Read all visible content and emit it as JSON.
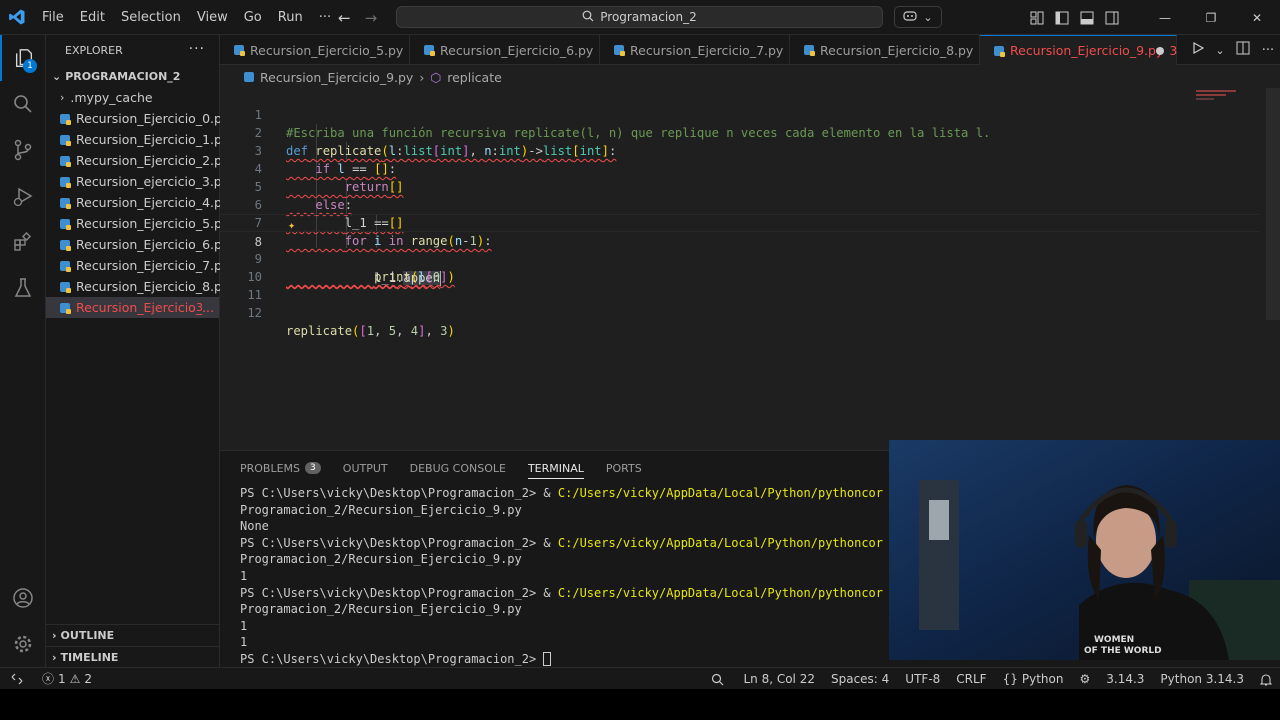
{
  "titlebar": {
    "menu": [
      "File",
      "Edit",
      "Selection",
      "View",
      "Go",
      "Run"
    ],
    "more": "···",
    "search_text": "Programacion_2"
  },
  "activitybar": {
    "explorer_badge": "1"
  },
  "sidebar": {
    "title": "EXPLORER",
    "more": "···",
    "folder": "PROGRAMACION_2",
    "items": [
      {
        "label": ".mypy_cache",
        "type": "folder"
      },
      {
        "label": "Recursion_Ejercicio_0.py"
      },
      {
        "label": "Recursion_Ejercicio_1.py"
      },
      {
        "label": "Recursion_Ejercicio_2.py"
      },
      {
        "label": "Recursion_ejercicio_3.py"
      },
      {
        "label": "Recursion_Ejercicio_4.py"
      },
      {
        "label": "Recursion_Ejercicio_5.py"
      },
      {
        "label": "Recursion_Ejercicio_6.py"
      },
      {
        "label": "Recursion_Ejercicio_7.py"
      },
      {
        "label": "Recursion_Ejercicio_8.py"
      },
      {
        "label": "Recursion_Ejercicio_...",
        "count": "3"
      }
    ],
    "outline": "OUTLINE",
    "timeline": "TIMELINE"
  },
  "tabs": [
    {
      "label": "Recursion_Ejercicio_5.py"
    },
    {
      "label": "Recursion_Ejercicio_6.py"
    },
    {
      "label": "Recursion_Ejercicio_7.py"
    },
    {
      "label": "Recursion_Ejercicio_8.py"
    },
    {
      "label": "Recursion_Ejercicio_9.py",
      "count": "3"
    }
  ],
  "breadcrumb": {
    "file": "Recursion_Ejercicio_9.py",
    "symbol": "replicate"
  },
  "editor": {
    "line_numbers": [
      "1",
      "2",
      "3",
      "4",
      "5",
      "6",
      "7",
      "8",
      "9",
      "10",
      "11",
      "12"
    ],
    "current_line": 8,
    "lines": [
      "#Escriba una función recursiva replicate(l, n) que replique n veces cada elemento en la lista l.",
      "def replicate(l:list[int], n:int)->list[int]:",
      "    if l == []:",
      "        return[]",
      "    else:",
      "        l_1 ==[]",
      "        for i in range(n-1):",
      "            l_1.appen",
      "            print(l[0])",
      "",
      "",
      "replicate([1, 5, 4], 3)"
    ]
  },
  "panel": {
    "tabs": [
      {
        "label": "PROBLEMS",
        "badge": "3"
      },
      {
        "label": "OUTPUT"
      },
      {
        "label": "DEBUG CONSOLE"
      },
      {
        "label": "TERMINAL"
      },
      {
        "label": "PORTS"
      }
    ],
    "terminal_lines": [
      {
        "prompt": "PS C:\\Users\\vicky\\Desktop\\Programacion_2> & ",
        "path": "C:/Users/vicky/AppData/Local/Python/pythoncor"
      },
      {
        "text": "Programacion_2/Recursion_Ejercicio_9.py"
      },
      {
        "text": "None"
      },
      {
        "prompt": "PS C:\\Users\\vicky\\Desktop\\Programacion_2> & ",
        "path": "C:/Users/vicky/AppData/Local/Python/pythoncor"
      },
      {
        "text": "Programacion_2/Recursion_Ejercicio_9.py"
      },
      {
        "text": "1"
      },
      {
        "prompt": "PS C:\\Users\\vicky\\Desktop\\Programacion_2> & ",
        "path": "C:/Users/vicky/AppData/Local/Python/pythoncor"
      },
      {
        "text": "Programacion_2/Recursion_Ejercicio_9.py"
      },
      {
        "text": "1"
      },
      {
        "text": "1"
      },
      {
        "prompt": "PS C:\\Users\\vicky\\Desktop\\Programacion_2> ",
        "path": ""
      }
    ]
  },
  "statusbar": {
    "errors": "1",
    "warnings": "2",
    "position": "Ln 8, Col 22",
    "spaces": "Spaces: 4",
    "encoding": "UTF-8",
    "eol": "CRLF",
    "language": "Python",
    "python_env": "3.14.3",
    "interpreter": "Python 3.14.3"
  },
  "colors": {
    "accent": "#0078d4",
    "error": "#f14c4c",
    "terminal_path": "#e5e510"
  },
  "icons": [
    "vscode-logo-icon",
    "back-arrow-icon",
    "forward-arrow-icon",
    "search-icon",
    "copilot-icon",
    "explorer-icon",
    "search-view-icon",
    "source-control-icon",
    "run-debug-icon",
    "extensions-icon",
    "testing-icon",
    "account-icon",
    "settings-gear-icon",
    "run-icon",
    "split-editor-icon",
    "lightbulb-icon",
    "remote-icon",
    "bell-icon"
  ]
}
